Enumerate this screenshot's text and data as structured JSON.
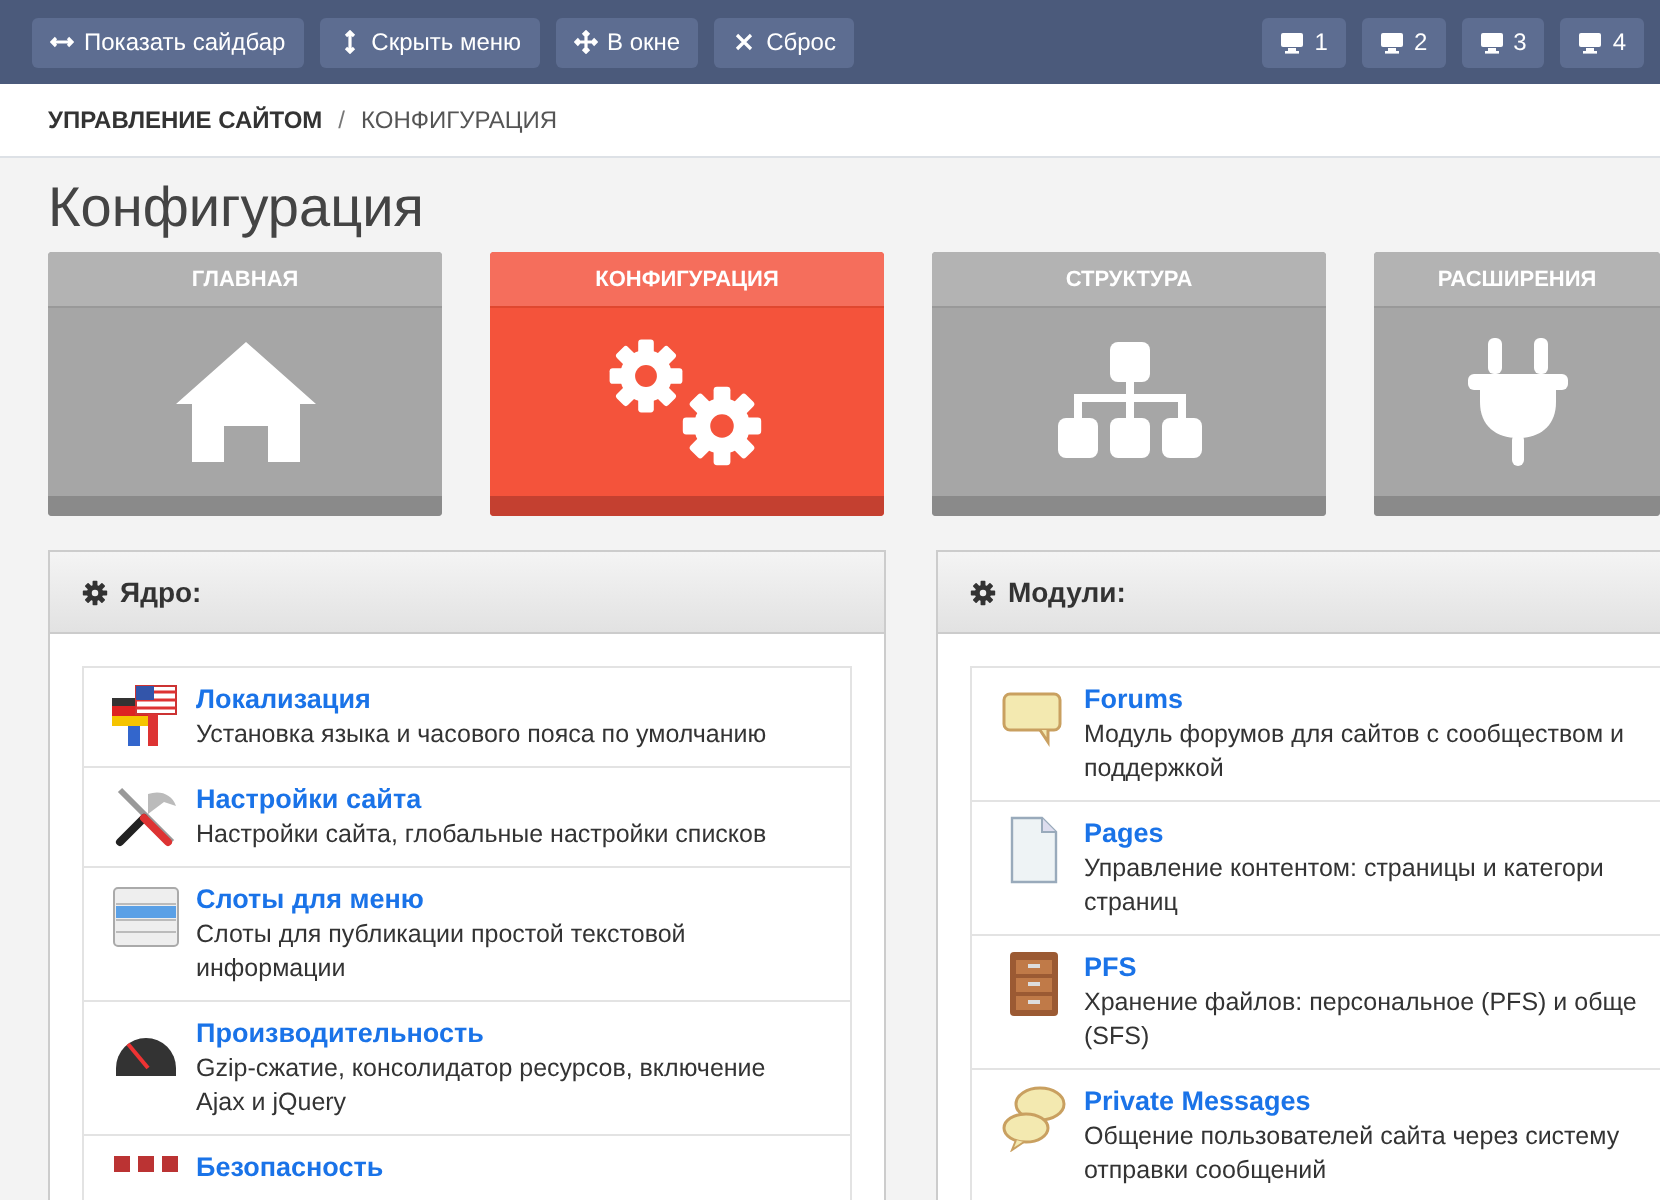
{
  "toolbar": {
    "left_buttons": [
      "Показать сайдбар",
      "Скрыть меню",
      "В окне",
      "Сброс"
    ],
    "screen_buttons": [
      "1",
      "2",
      "3",
      "4"
    ]
  },
  "breadcrumb": {
    "items": [
      "УПРАВЛЕНИЕ САЙТОМ",
      "КОНФИГУРАЦИЯ"
    ],
    "separator": "/"
  },
  "title": "Конфигурация",
  "tiles": [
    {
      "label": "ГЛАВНАЯ",
      "selected": false
    },
    {
      "label": "КОНФИГУРАЦИЯ",
      "selected": true
    },
    {
      "label": "СТРУКТУРА",
      "selected": false
    },
    {
      "label": "РАСШИРЕНИЯ",
      "selected": false
    }
  ],
  "panels": [
    {
      "title": "Ядро:",
      "items": [
        {
          "name": "Локализация",
          "lines": [
            "Установка языка и часового пояса по умолчанию"
          ]
        },
        {
          "name": "Настройки сайта",
          "lines": [
            "Настройки сайта, глобальные настройки списков"
          ]
        },
        {
          "name": "Слоты для меню",
          "lines": [
            "Слоты для публикации простой текстовой",
            "информации"
          ]
        },
        {
          "name": "Производительность",
          "lines": [
            "Gzip-сжатие, консолидатор ресурсов, включение",
            "Ajax и jQuery"
          ]
        },
        {
          "name": "Безопасность"
        }
      ]
    },
    {
      "title": "Модули:",
      "items": [
        {
          "name": "Forums",
          "lines": [
            "Модуль форумов для сайтов с сообществом и",
            "поддержкой"
          ]
        },
        {
          "name": "Pages",
          "lines": [
            "Управление контентом: страницы и категори",
            "страниц"
          ]
        },
        {
          "name": "PFS",
          "lines": [
            "Хранение файлов: персональное (PFS) и обще",
            "(SFS)"
          ]
        },
        {
          "name": "Private Messages",
          "lines": [
            "Общение пользователей сайта через систему",
            "отправки сообщений"
          ]
        }
      ]
    }
  ]
}
